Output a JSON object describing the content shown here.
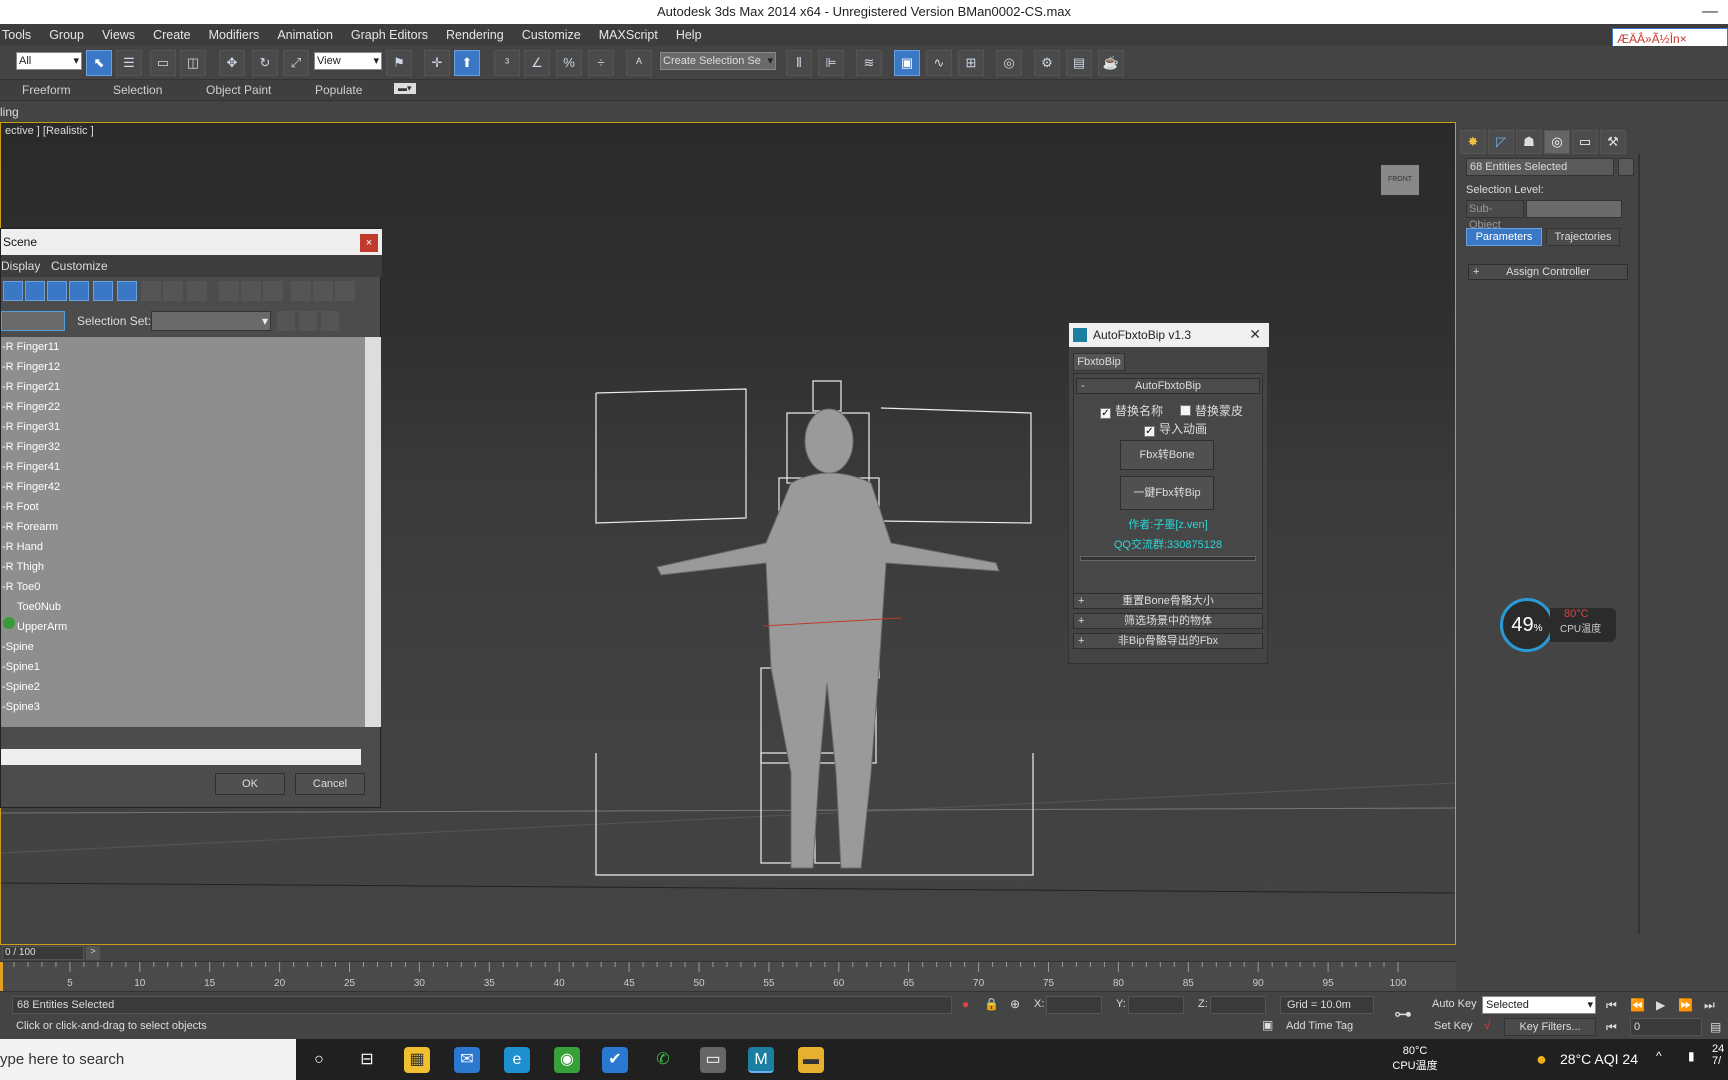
{
  "app": {
    "title": "Autodesk 3ds Max  2014 x64  - Unregistered Version   BMan0002-CS.max",
    "logo_text": "ÆÄÂ»Ã½Ìn×"
  },
  "menu": [
    "Tools",
    "Group",
    "Views",
    "Create",
    "Modifiers",
    "Animation",
    "Graph Editors",
    "Rendering",
    "Customize",
    "MAXScript",
    "Help"
  ],
  "toolbar": {
    "filter_value": "All",
    "refcoord_value": "View",
    "named_sel_placeholder": "Create Selection Se"
  },
  "ribbon": [
    "Freeform",
    "Selection",
    "Object Paint",
    "Populate"
  ],
  "ribbon_sub": "ling",
  "viewport": {
    "label": "ective ] [Realistic ]",
    "viewcube": "FRONT"
  },
  "scene_dialog": {
    "title": "Scene",
    "menus": [
      "Display",
      "Customize"
    ],
    "selection_set_label": "Selection Set:",
    "items": [
      "-R Finger11",
      "-R Finger12",
      "-R Finger21",
      "-R Finger22",
      "-R Finger31",
      "-R Finger32",
      "-R Finger41",
      "-R Finger42",
      "-R Foot",
      "-R Forearm",
      "-R Hand",
      "-R Thigh",
      "-R Toe0",
      "Toe0Nub",
      "UpperArm",
      "-Spine",
      "-Spine1",
      "-Spine2",
      "-Spine3"
    ],
    "ok": "OK",
    "cancel": "Cancel"
  },
  "plugin": {
    "title": "AutoFbxtoBip v1.3",
    "tab": "FbxtoBip",
    "rollout_title": "AutoFbxtoBip",
    "chk_rename": "替换名称",
    "chk_rename_checked": true,
    "chk_skin": "替换蒙皮",
    "chk_skin_checked": false,
    "chk_anim": "导入动画",
    "chk_anim_checked": true,
    "btn_bone": "Fbx转Bone",
    "btn_bip": "一鍵Fbx转Bip",
    "author": "作者:子墨[z.ven]",
    "qq": "QQ交流群:330875128",
    "rollups": [
      "重置Bone骨骼大小",
      "筛选场景中的物体",
      "非Bip骨骼导出的Fbx"
    ]
  },
  "command_panel": {
    "name_field": "68 Entities Selected",
    "selection_level": "Selection Level:",
    "sub_object": "Sub-Object",
    "tab_parameters": "Parameters",
    "tab_trajectories": "Trajectories",
    "assign_controller": "Assign Controller"
  },
  "cpu_widget": {
    "percent": "49",
    "unit": "%",
    "temp": "80°C",
    "label": "CPU温度"
  },
  "timeline": {
    "frame": "0 / 100",
    "ticks": [
      "5",
      "10",
      "15",
      "20",
      "25",
      "30",
      "35",
      "40",
      "45",
      "50",
      "55",
      "60",
      "65",
      "70",
      "75",
      "80",
      "85",
      "90",
      "95",
      "100"
    ]
  },
  "status": {
    "selection": "68 Entities Selected",
    "prompt": "Click or click-and-drag to select objects",
    "x_label": "X:",
    "y_label": "Y:",
    "z_label": "Z:",
    "grid": "Grid = 10.0m",
    "add_time_tag": "Add Time Tag",
    "auto_key": "Auto Key",
    "set_key": "Set Key",
    "selected": "Selected",
    "key_filters": "Key Filters...",
    "frame_value": "0"
  },
  "taskbar": {
    "search": "ype here to search",
    "cpu_temp": "80°C",
    "cpu_label": "CPU温度",
    "weather": "28°C  AQI 24",
    "clock": "24\n7/"
  }
}
